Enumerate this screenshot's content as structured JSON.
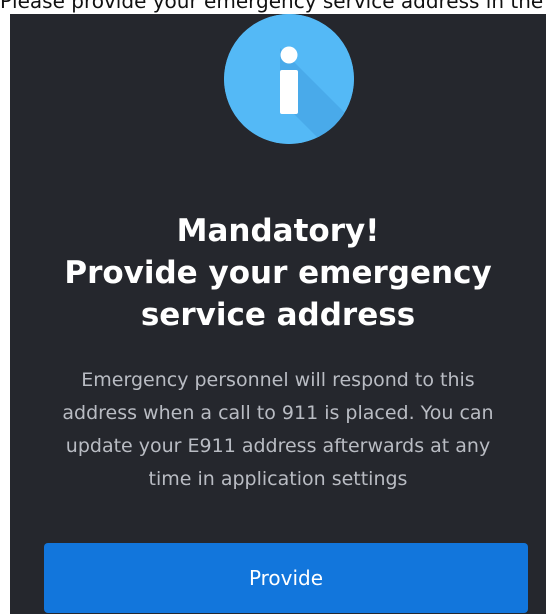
{
  "background_text": "Please provide your emergency service address in the case you call",
  "dialog": {
    "title_lines": [
      "Mandatory!",
      "Provide your emergency",
      "service address"
    ],
    "description_lines": [
      "Emergency personnel will respond to this",
      "address when a call to 911 is placed. You can",
      "update your E911 address afterwards at any",
      "time in application settings"
    ],
    "provide_label": "Provide",
    "icon": "info-icon"
  },
  "colors": {
    "dialog_bg": "#25272d",
    "icon_circle": "#54b9f6",
    "button": "#1276dc",
    "description_text": "#b9bcc3"
  }
}
